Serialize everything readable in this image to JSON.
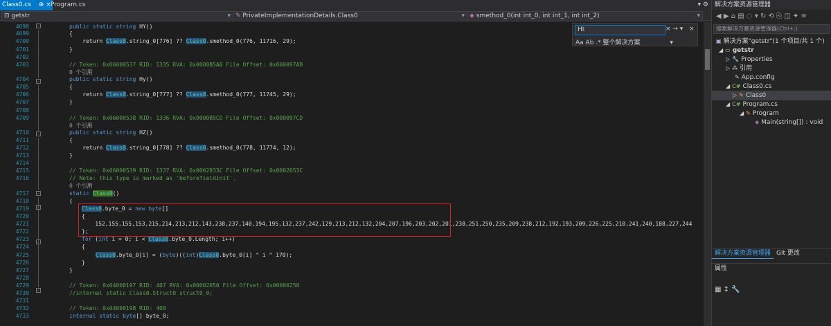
{
  "tabs": {
    "active_label": "Class0.cs",
    "active_pin": "⊕ ×",
    "second_label": "Program.cs",
    "window_controls": "▾ ⚙"
  },
  "navbar": {
    "project_combo": "getstr",
    "class_combo": "PrivateImplementationDetails.Class0",
    "member_combo": "smethod_0(int int_0, int int_1, int int_2)"
  },
  "editor": {
    "line_numbers": [
      "4698",
      "4699",
      "4700",
      "4701",
      "4702",
      "4703",
      "",
      "4704",
      "4705",
      "4706",
      "4707",
      "4708",
      "4709",
      "",
      "4710",
      "4711",
      "4712",
      "4713",
      "4714",
      "4715",
      "4716",
      "",
      "4717",
      "4718",
      "4719",
      "4720",
      "4721",
      "4722",
      "4723",
      "4724",
      "4725",
      "4726",
      "4727",
      "4728",
      "4729",
      "4730",
      "4731",
      "4732",
      "4733"
    ],
    "lines": {
      "l4698_kw": "public static string",
      "l4698_rest": " HY()",
      "l4699": "{",
      "l4700_a": "    return ",
      "l4700_cls": "Class0",
      "l4700_b": ".string_0[776] ?? ",
      "l4700_cls2": "Class0",
      "l4700_c": ".smethod_0(776, 11716, 29);",
      "l4701": "}",
      "l4703": "// Token: 0x06000537 RID: 1335 RVA: 0x0000B5AB File Offset: 0x000097AB",
      "ref1": "0 个引用",
      "l4704_kw": "public static string",
      "l4704_rest": " Hy()",
      "l4705": "{",
      "l4706_a": "    return ",
      "l4706_cls": "Class0",
      "l4706_b": ".string_0[777] ?? ",
      "l4706_cls2": "Class0",
      "l4706_c": ".smethod_0(777, 11745, 29);",
      "l4707": "}",
      "l4709": "// Token: 0x06000538 RID: 1336 RVA: 0x0000B5CD File Offset: 0x000097CD",
      "ref2": "0 个引用",
      "l4710_kw": "public static string",
      "l4710_rest": " HZ()",
      "l4711": "{",
      "l4712_a": "    return ",
      "l4712_cls": "Class0",
      "l4712_b": ".string_0[778] ?? ",
      "l4712_cls2": "Class0",
      "l4712_c": ".smethod_0(778, 11774, 12);",
      "l4713": "}",
      "l4715": "// Token: 0x06000539 RID: 1337 RVA: 0x0002833C File Offset: 0x0002653C",
      "l4716": "// Note: this type is marked as 'beforefieldinit'.",
      "ref3": "0 个引用",
      "l4717_kw": "static",
      "l4717_cls": "Class0",
      "l4717_rest": "()",
      "l4718": "{",
      "l4719_cls": "Class0",
      "l4719_b": ".byte_0 = ",
      "l4719_kw": "new byte",
      "l4719_c": "[]",
      "l4720": "{",
      "l4721": "    152,155,155,153,215,214,213,212,143,238,237,140,194,195,132,237,242,129,213,212,132,204,207,196,203,202,201,238,251,250,235,209,238,212,192,193,209,226,225,210,241,240,188,227,244",
      "l4722": "};",
      "l4723_kw": "for",
      "l4723_a": " (",
      "l4723_kw2": "int",
      "l4723_b": " i = 0; i < ",
      "l4723_cls": "Class0",
      "l4723_c": ".byte_0.Length; i++)",
      "l4724": "{",
      "l4725_cls": "Class0",
      "l4725_a": ".byte_0[i] = (",
      "l4725_kw": "byte",
      "l4725_b": ")((",
      "l4725_kw2": "int",
      "l4725_c": ")",
      "l4725_cls2": "Class0",
      "l4725_d": ".byte_0[i] ^ i ^ 170);",
      "l4726": "}",
      "l4727": "}",
      "l4729": "// Token: 0x04000197 RID: 407 RVA: 0x00002050 File Offset: 0x00000250",
      "l4730": "//internal static Class0.Struct0 struct0_0;",
      "l4732": "// Token: 0x04000198 RID: 408",
      "l4733_kw": "internal static byte",
      "l4733_rest": "[] byte_0;"
    }
  },
  "find": {
    "query": "Ht",
    "buttons": "× → ▾",
    "options": "Aa  Ab  .*  整个解决方案",
    "close": "×",
    "opt_arrow": "▾"
  },
  "solution_explorer": {
    "title": "解决方案资源管理器",
    "toolbar": "◀ ▶ ⌂ ▤ ◌ ▾ ↻ ⟲ ⎘ ◫ ✦ ≡",
    "search_placeholder": "搜索解决方案资源管理器(Ctrl+;)",
    "solution": "解决方案\"getstr\"(1 个项目/共 1 个)",
    "project": "getstr",
    "properties": "Properties",
    "references": "引用",
    "appconfig": "App.config",
    "class0_cs": "Class0.cs",
    "class0": "Class0",
    "program_cs": "Program.cs",
    "program": "Program",
    "main": "Main(string[]) : void"
  },
  "bottom_tabs": {
    "solution_tab": "解决方案资源管理器",
    "git_tab": "Git 更改"
  },
  "properties": {
    "title": "属性",
    "toolbar": "▦ ↕ 🔧"
  },
  "colors": {
    "accent": "#007acc",
    "highlight_box": "#e02020"
  }
}
